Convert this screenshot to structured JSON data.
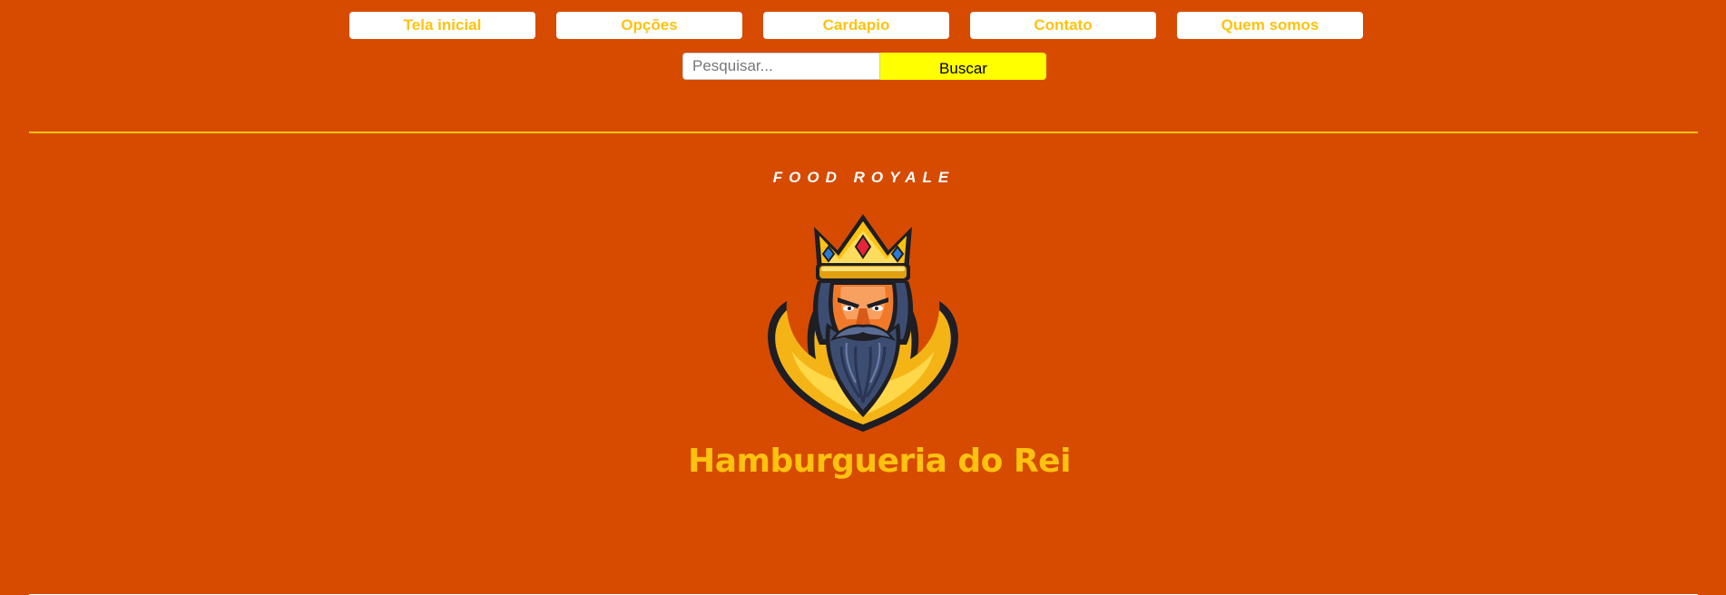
{
  "nav": {
    "items": [
      {
        "label": "Tela inicial"
      },
      {
        "label": "Opções"
      },
      {
        "label": "Cardapio"
      },
      {
        "label": "Contato"
      },
      {
        "label": "Quem somos"
      }
    ]
  },
  "search": {
    "placeholder": "Pesquisar...",
    "value": "",
    "button_label": "Buscar"
  },
  "hero": {
    "tagline": "FOOD ROYALE",
    "logo_icon": "bearded-king-icon",
    "name": "Hamburgueria do Rei"
  },
  "colors": {
    "background": "#d64b00",
    "accent": "#ffc20e",
    "search_button": "#ffff00"
  }
}
